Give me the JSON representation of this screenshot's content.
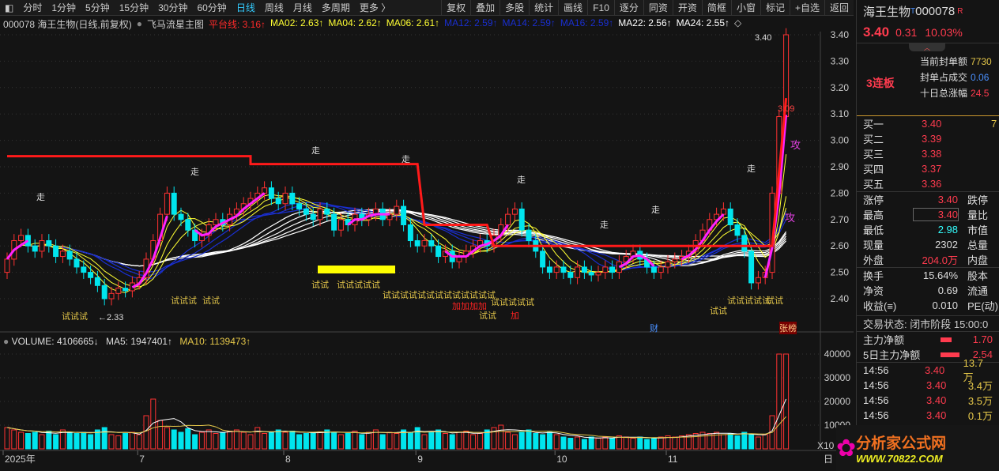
{
  "toolbar": {
    "left": [
      "分时",
      "1分钟",
      "5分钟",
      "15分钟",
      "30分钟",
      "60分钟",
      "日线",
      "周线",
      "月线",
      "多周期",
      "更多 〉"
    ],
    "active": "日线",
    "right": [
      "复权",
      "叠加",
      "多股",
      "统计",
      "画线",
      "F10",
      "逐分",
      "同资",
      "开资",
      "简框",
      "小窗",
      "标记",
      "+自选",
      "返回"
    ]
  },
  "legend": {
    "title": "000078 海王生物(日线,前复权)",
    "indicator": "飞马流星主图",
    "items": [
      {
        "label": "平台线: 3.16↑",
        "color": "#ff2a2a"
      },
      {
        "label": "MA02: 2.63↑",
        "color": "#ffff33"
      },
      {
        "label": "MA04: 2.62↑",
        "color": "#ffff33"
      },
      {
        "label": "MA06: 2.61↑",
        "color": "#ffff33"
      },
      {
        "label": "MA12: 2.59↑",
        "color": "#1a2fd0"
      },
      {
        "label": "MA14: 2.59↑",
        "color": "#1a2fd0"
      },
      {
        "label": "MA16: 2.59↑",
        "color": "#1a2fd0"
      },
      {
        "label": "MA22: 2.56↑",
        "color": "#ffffff"
      },
      {
        "label": "MA24: 2.55↑",
        "color": "#ffffff"
      }
    ]
  },
  "volume_legend": {
    "volume": "VOLUME: 4106665↓",
    "ma5": "MA5: 1947401↑",
    "ma10": "MA10: 1139473↑"
  },
  "chart_data": {
    "type": "candlestick",
    "price_axis": {
      "ticks": [
        2.4,
        2.5,
        2.6,
        2.7,
        2.8,
        2.9,
        3.0,
        3.1,
        3.2,
        3.3,
        3.4
      ]
    },
    "volume_axis": {
      "ticks": [
        10000,
        20000,
        30000,
        40000
      ],
      "unit_label": "X10"
    },
    "x_ticks": [
      {
        "label": "2025年",
        "bar": 0
      },
      {
        "label": "7",
        "bar": 19
      },
      {
        "label": "8",
        "bar": 40
      },
      {
        "label": "9",
        "bar": 59
      },
      {
        "label": "10",
        "bar": 79
      },
      {
        "label": "11",
        "bar": 95
      }
    ],
    "x_end_label": "日",
    "close": [
      2.55,
      2.62,
      2.64,
      2.6,
      2.58,
      2.62,
      2.6,
      2.56,
      2.58,
      2.55,
      2.52,
      2.5,
      2.48,
      2.45,
      2.4,
      2.42,
      2.44,
      2.43,
      2.46,
      2.48,
      2.55,
      2.62,
      2.72,
      2.8,
      2.72,
      2.7,
      2.66,
      2.62,
      2.64,
      2.68,
      2.7,
      2.68,
      2.72,
      2.74,
      2.76,
      2.78,
      2.8,
      2.82,
      2.78,
      2.76,
      2.8,
      2.76,
      2.74,
      2.72,
      2.7,
      2.74,
      2.72,
      2.66,
      2.7,
      2.68,
      2.72,
      2.7,
      2.72,
      2.74,
      2.7,
      2.72,
      2.75,
      2.68,
      2.62,
      2.6,
      2.62,
      2.6,
      2.56,
      2.58,
      2.54,
      2.56,
      2.58,
      2.6,
      2.62,
      2.6,
      2.64,
      2.68,
      2.72,
      2.74,
      2.66,
      2.62,
      2.58,
      2.52,
      2.5,
      2.52,
      2.5,
      2.48,
      2.52,
      2.5,
      2.49,
      2.5,
      2.52,
      2.5,
      2.54,
      2.56,
      2.58,
      2.55,
      2.52,
      2.5,
      2.52,
      2.54,
      2.55,
      2.56,
      2.58,
      2.62,
      2.66,
      2.7,
      2.72,
      2.74,
      2.68,
      2.64,
      2.58,
      2.46,
      2.48,
      2.5,
      2.8,
      3.09,
      3.4
    ],
    "volume": [
      9000,
      8000,
      7000,
      6500,
      7000,
      6000,
      7500,
      6000,
      8000,
      7000,
      6500,
      7000,
      6000,
      8000,
      9000,
      6000,
      5500,
      6500,
      7000,
      6000,
      14000,
      21000,
      12000,
      9000,
      8000,
      7000,
      8500,
      6000,
      7000,
      8000,
      6500,
      7000,
      7500,
      8000,
      7000,
      6000,
      9000,
      6500,
      7000,
      8000,
      7000,
      7500,
      6000,
      6500,
      7000,
      7200,
      8000,
      7000,
      6000,
      6500,
      7500,
      6000,
      7000,
      8000,
      6000,
      7000,
      6500,
      8000,
      7000,
      9000,
      6000,
      7000,
      8000,
      6500,
      6000,
      7000,
      7500,
      6000,
      6500,
      8000,
      9000,
      10000,
      7000,
      6000,
      7000,
      8000,
      6500,
      6000,
      7000,
      6000,
      5000,
      4500,
      5000,
      4000,
      5000,
      4500,
      5000,
      4500,
      5500,
      5000,
      4500,
      5000,
      4000,
      4500,
      5000,
      5500,
      5000,
      5500,
      6000,
      6500,
      7000,
      6500,
      7000,
      6000,
      6500,
      5500,
      7000,
      6000,
      5000,
      6000,
      14000,
      40000,
      40000
    ],
    "platform_line": [
      [
        0,
        2.94
      ],
      [
        35,
        2.94
      ],
      [
        35,
        2.91
      ],
      [
        59,
        2.91
      ],
      [
        60,
        2.68
      ],
      [
        69,
        2.68
      ],
      [
        70,
        2.6
      ],
      [
        110,
        2.6
      ],
      [
        112,
        3.16
      ]
    ],
    "annotations": {
      "high_label": "3.40",
      "low_label": "←2.33",
      "mid_label": "3.09"
    }
  },
  "chart_text": {
    "walk": "走",
    "attack": "攻",
    "try3": "试试试",
    "try2": "试试",
    "try_long": "试试试试试试试试试试试试试",
    "add": "加加加加",
    "add1": "加",
    "try6": "试试试试试",
    "cai": "财",
    "zhangbang": "张榜"
  },
  "quote": {
    "name": "海王生物",
    "t": "T",
    "code": "000078",
    "r": "R",
    "price": "3.40",
    "change": "0.31",
    "pct": "10.03%",
    "limit_text": "3连板",
    "seal": [
      {
        "label": "当前封单额",
        "value": "7730"
      },
      {
        "label": "封单占成交",
        "value": "0.06"
      },
      {
        "label": "十日总涨幅",
        "value": "24.5"
      }
    ],
    "bids": [
      {
        "label": "买一",
        "price": "3.40",
        "vol": "7"
      },
      {
        "label": "买二",
        "price": "3.39"
      },
      {
        "label": "买三",
        "price": "3.38"
      },
      {
        "label": "买四",
        "price": "3.37"
      },
      {
        "label": "买五",
        "price": "3.36"
      }
    ],
    "stats1": [
      {
        "l": "涨停",
        "v": "3.40",
        "r": "跌停"
      },
      {
        "l": "最高",
        "v": "3.40",
        "r": "量比"
      },
      {
        "l": "最低",
        "v": "2.98",
        "r": "市值"
      },
      {
        "l": "现量",
        "v": "2302",
        "r": "总量"
      },
      {
        "l": "外盘",
        "v": "204.0万",
        "r": "内盘"
      }
    ],
    "stats2": [
      {
        "l": "换手",
        "v": "15.64%",
        "r": "股本"
      },
      {
        "l": "净资",
        "v": "0.69",
        "r": "流通"
      },
      {
        "l": "收益(≡)",
        "v": "0.010",
        "r": "PE(动)"
      }
    ],
    "status": "交易状态: 闭市阶段 15:00:0",
    "flow": [
      {
        "l": "主力净额",
        "v": "1.70"
      },
      {
        "l": "5日主力净额",
        "v": "2.54"
      }
    ],
    "ticks": [
      {
        "t": "14:56",
        "p": "3.40",
        "v": "13.7万"
      },
      {
        "t": "14:56",
        "p": "3.40",
        "v": "3.4万"
      },
      {
        "t": "14:56",
        "p": "3.40",
        "v": "3.5万"
      },
      {
        "t": "14:56",
        "p": "3.40",
        "v": "0.1万"
      }
    ]
  },
  "watermark": {
    "title": "分析家公式网",
    "url": "WWW.70822.COM"
  }
}
